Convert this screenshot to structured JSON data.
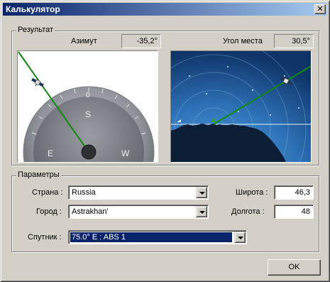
{
  "window": {
    "title": "Калькулятор",
    "close_glyph": "✕"
  },
  "result": {
    "group_label": "Результат",
    "azimuth_label": "Азимут",
    "azimuth_value": "-35,2°",
    "elevation_label": "Угол места",
    "elevation_value": "30,5°",
    "compass": {
      "n": "0",
      "s": "S",
      "e": "E",
      "w": "W"
    }
  },
  "params": {
    "group_label": "Параметры",
    "country_label": "Страна :",
    "country_value": "Russia",
    "city_label": "Город :",
    "city_value": "Astrakhan'",
    "latitude_label": "Широта :",
    "latitude_value": "46,3",
    "longitude_label": "Долгота :",
    "longitude_value": "48",
    "satellite_label": "Спутник :",
    "satellite_value": "75.0° E : ABS 1"
  },
  "ok_label": "OK",
  "colors": {
    "titlebar_start": "#0a246a",
    "titlebar_end": "#a6caf0",
    "beam": "#118811",
    "sky": "#2a6fb4",
    "selection": "#0a246a"
  },
  "icons": [
    "close-icon",
    "satellite-icon",
    "compass-icon",
    "dropdown-arrow-icon"
  ]
}
